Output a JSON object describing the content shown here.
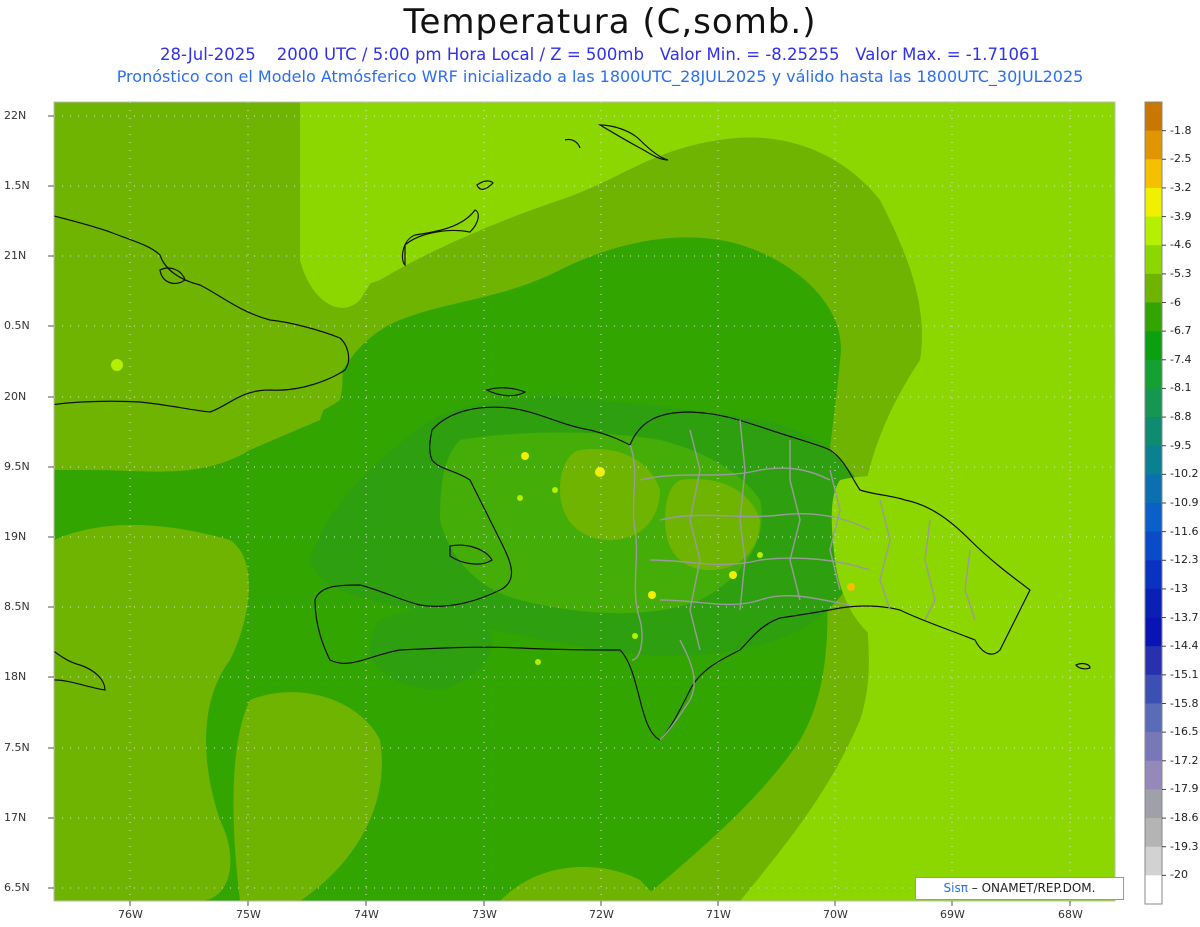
{
  "title": "Temperatura (C,somb.)",
  "subtitle_parts": [
    "28-Jul-2025",
    "2000 UTC / 5:00 pm Hora Local / Z = 500mb",
    "Valor Min. = -8.25255",
    "Valor Max. = -1.71061"
  ],
  "subtitle2": "Pronóstico con el Modelo Atmósferico WRF inicializado a las 1800UTC_28JUL2025 y válido hasta las  1800UTC_30JUL2025",
  "lat_labels": [
    "22N",
    "1.5N",
    "21N",
    "0.5N",
    "20N",
    "9.5N",
    "19N",
    "8.5N",
    "18N",
    "7.5N",
    "17N",
    "6.5N"
  ],
  "lon_labels": [
    "76W",
    "75W",
    "74W",
    "73W",
    "72W",
    "71W",
    "70W",
    "69W",
    "68W"
  ],
  "legend": {
    "labels": [
      "-1.8",
      "-2.5",
      "-3.2",
      "-3.9",
      "-4.6",
      "-5.3",
      "-6",
      "-6.7",
      "-7.4",
      "-8.1",
      "-8.8",
      "-9.5",
      "-10.2",
      "-10.9",
      "-11.6",
      "-12.3",
      "-13",
      "-13.7",
      "-14.4",
      "-15.1",
      "-15.8",
      "-16.5",
      "-17.2",
      "-17.9",
      "-18.6",
      "-19.3",
      "-20"
    ],
    "colors": [
      "#c87800",
      "#e09600",
      "#f5c000",
      "#f0f000",
      "#b4f000",
      "#8cd700",
      "#6eb400",
      "#32a500",
      "#0aa010",
      "#15a032",
      "#169650",
      "#108a70",
      "#0a8090",
      "#0a70b0",
      "#0a60c8",
      "#0a4cc8",
      "#0a32c0",
      "#0a20b4",
      "#0a14b4",
      "#2830b0",
      "#3c50b4",
      "#5a6cb8",
      "#7878b8",
      "#9688b8",
      "#a0a0a8",
      "#b4b4b4",
      "#d2d2d2",
      "#ffffff"
    ]
  },
  "credit": {
    "sis": "Sisπ",
    "rest": " – ONAMET/REP.DOM."
  }
}
